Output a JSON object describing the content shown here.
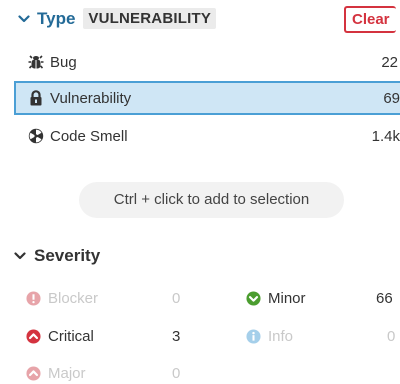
{
  "type_facet": {
    "title": "Type",
    "selected_value": "VULNERABILITY",
    "clear_label": "Clear",
    "items": [
      {
        "label": "Bug",
        "count": "22",
        "icon": "bug-icon",
        "selected": false
      },
      {
        "label": "Vulnerability",
        "count": "69",
        "icon": "lock-icon",
        "selected": true
      },
      {
        "label": "Code Smell",
        "count": "1.4k",
        "icon": "code-smell-icon",
        "selected": false
      }
    ],
    "hint": "Ctrl + click to add to selection"
  },
  "severity_facet": {
    "title": "Severity",
    "items": [
      {
        "label": "Blocker",
        "count": "0",
        "icon": "blocker-icon",
        "color": "#d4333f",
        "dimmed": true
      },
      {
        "label": "Minor",
        "count": "66",
        "icon": "minor-icon",
        "color": "#4b9d2f",
        "dimmed": false
      },
      {
        "label": "Critical",
        "count": "3",
        "icon": "critical-icon",
        "color": "#d4333f",
        "dimmed": false
      },
      {
        "label": "Info",
        "count": "0",
        "icon": "info-icon",
        "color": "#4b9fd5",
        "dimmed": true
      },
      {
        "label": "Major",
        "count": "0",
        "icon": "major-icon",
        "color": "#d4333f",
        "dimmed": true
      }
    ]
  },
  "colors": {
    "accent": "#236a97",
    "selected_bg": "#cfe6f5",
    "selected_border": "#4b9fd5",
    "danger": "#d4333f"
  }
}
